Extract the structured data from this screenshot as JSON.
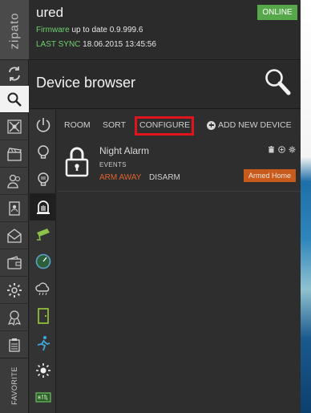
{
  "app": {
    "logo": "zipato",
    "user": "ured",
    "status_badge": "ONLINE",
    "firmware_label": "Firmware",
    "firmware_text": " up to date 0.9.999.6",
    "sync_label": "LAST SYNC",
    "sync_time": " 18.06.2015 13:45:56",
    "favorite_label": "FAVORITE"
  },
  "page": {
    "title": "Device browser"
  },
  "toolbar": {
    "room": "ROOM",
    "sort": "SORT",
    "configure": "CONFIGURE",
    "add_new_device": "ADD NEW DEVICE"
  },
  "device": {
    "name": "Night Alarm",
    "events_label": "EVENTS",
    "arm_away": "ARM AWAY",
    "disarm": "DISARM",
    "state_badge": "Armed Home"
  },
  "colors": {
    "online": "#56a84a",
    "accent_green": "#6fd16f",
    "arm_orange": "#e0632e",
    "badge_orange": "#c85a1b",
    "highlight_red": "#e0141c"
  },
  "icons": {
    "col1": [
      "sync-icon",
      "search-icon",
      "network-icon",
      "scenes-icon",
      "users-icon",
      "contacts-icon",
      "messages-icon",
      "wallet-icon",
      "settings-icon",
      "rules-icon",
      "clipboard-icon"
    ],
    "col2": [
      "power-icon",
      "bulb-icon",
      "bulb-dim-icon",
      "alarm-icon",
      "camera-icon",
      "meter-icon",
      "weather-icon",
      "door-icon",
      "motion-icon",
      "sun-icon",
      "http-icon"
    ]
  }
}
